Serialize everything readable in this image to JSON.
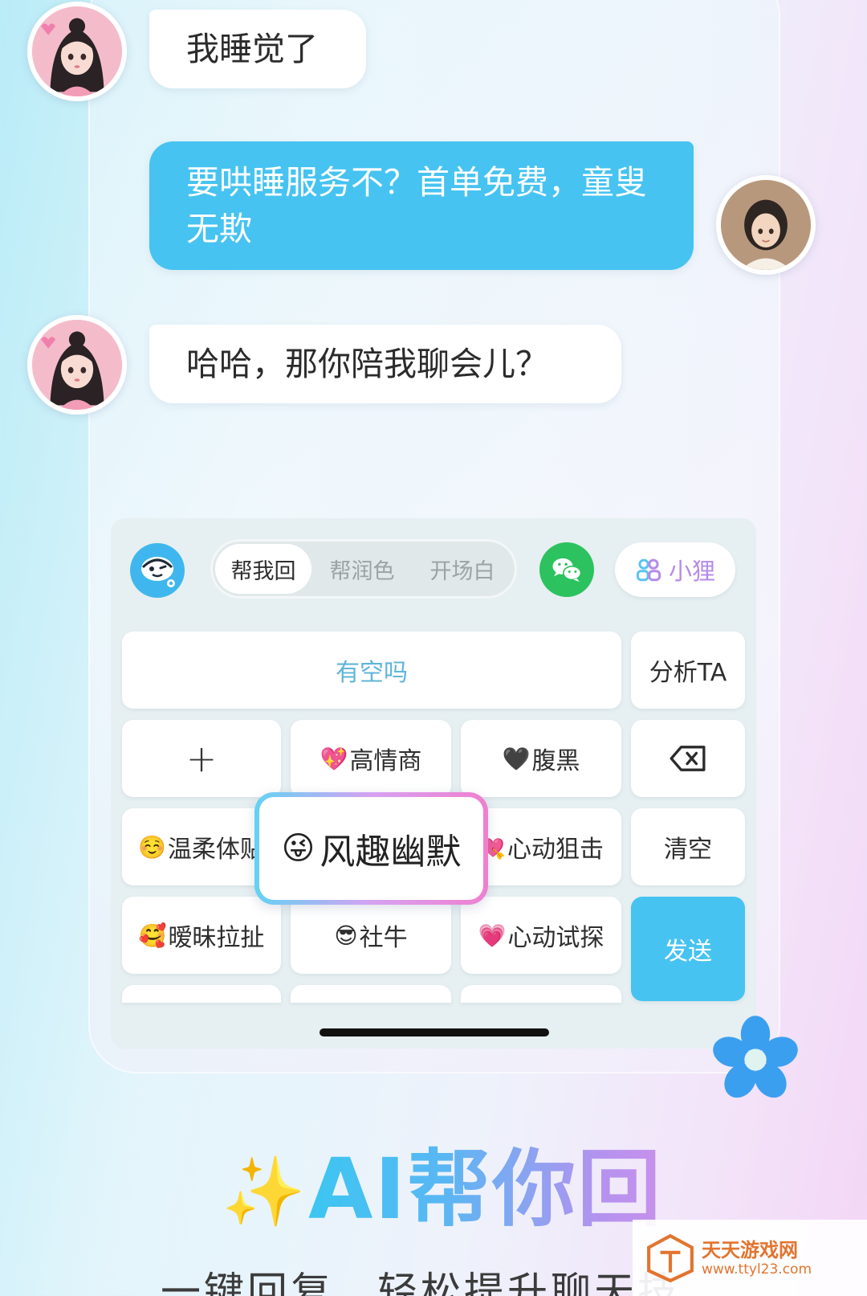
{
  "chat": {
    "messages": [
      {
        "side": "left",
        "avatar": "girl-avatar",
        "text": "我睡觉了"
      },
      {
        "side": "right",
        "avatar": "boy-avatar",
        "text": "要哄睡服务不？首单免费，童叟无欺"
      },
      {
        "side": "left",
        "avatar": "girl-avatar",
        "text": "哈哈，那你陪我聊会儿？"
      }
    ]
  },
  "toolbar": {
    "logo_icon": "mascot-logo-icon",
    "tabs": [
      {
        "label": "帮我回",
        "active": true
      },
      {
        "label": "帮润色",
        "active": false
      },
      {
        "label": "开场白",
        "active": false
      }
    ],
    "wechat_icon": "wechat-icon",
    "contact_label": "小狸",
    "contact_icon": "people-icon"
  },
  "keyboard": {
    "suggestion": "有空吗",
    "analyze_label": "分析TA",
    "add_label": "+",
    "tones": [
      {
        "emoji": "💖",
        "label": "高情商"
      },
      {
        "emoji": "🖤",
        "label": "腹黑"
      },
      {
        "emoji": "☺️",
        "label": "温柔体贴"
      },
      {
        "emoji": "💘",
        "label": "心动狙击"
      },
      {
        "emoji": "🥰",
        "label": "暧昧拉扯"
      },
      {
        "emoji": "😎",
        "label": "社牛"
      },
      {
        "emoji": "💗",
        "label": "心动试探"
      }
    ],
    "popup": {
      "emoji": "😜",
      "label": "风趣幽默"
    },
    "clear_label": "清空",
    "send_label": "发送",
    "backspace_icon": "backspace-icon"
  },
  "promo": {
    "sparkle": "✨",
    "title": "AI帮你回",
    "subtitle": "一键回复，轻松提升聊天技"
  },
  "watermark": {
    "title": "天天游戏网",
    "url": "www.ttyl23.com"
  },
  "colors": {
    "accent_blue": "#46c3f1",
    "wechat_green": "#2cc25f",
    "contact_purple": "#b58ae8"
  }
}
